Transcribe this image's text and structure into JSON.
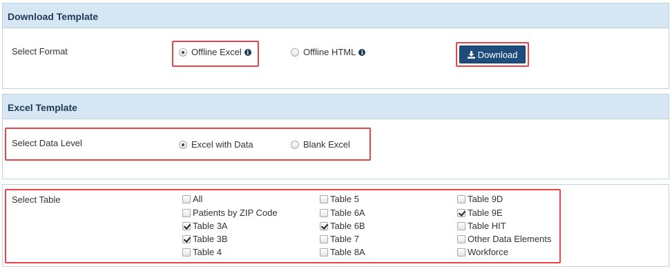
{
  "download_template": {
    "title": "Download Template",
    "select_format_label": "Select Format",
    "formats": [
      {
        "label": "Offline Excel",
        "checked": true
      },
      {
        "label": "Offline HTML",
        "checked": false
      }
    ],
    "download_label": "Download"
  },
  "excel_template": {
    "title": "Excel Template",
    "data_level_label": "Select Data Level",
    "levels": [
      {
        "label": "Excel with Data",
        "checked": true
      },
      {
        "label": "Blank Excel",
        "checked": false
      }
    ]
  },
  "select_table": {
    "label": "Select Table",
    "tables": [
      {
        "label": "All",
        "checked": false
      },
      {
        "label": "Patients by ZIP Code",
        "checked": false
      },
      {
        "label": "Table 3A",
        "checked": true
      },
      {
        "label": "Table 3B",
        "checked": true
      },
      {
        "label": "Table 4",
        "checked": false
      },
      {
        "label": "Table 5",
        "checked": false
      },
      {
        "label": "Table 6A",
        "checked": false
      },
      {
        "label": "Table 6B",
        "checked": true
      },
      {
        "label": "Table 7",
        "checked": false
      },
      {
        "label": "Table 8A",
        "checked": false
      },
      {
        "label": "Table 9D",
        "checked": false
      },
      {
        "label": "Table 9E",
        "checked": true
      },
      {
        "label": "Table HIT",
        "checked": false
      },
      {
        "label": "Other Data Elements",
        "checked": false
      },
      {
        "label": "Workforce",
        "checked": false
      }
    ]
  },
  "colors": {
    "header_bg": "#d6e6f3",
    "header_text": "#1e3a56",
    "button_bg": "#1e4d7b",
    "highlight": "#e8444a"
  }
}
